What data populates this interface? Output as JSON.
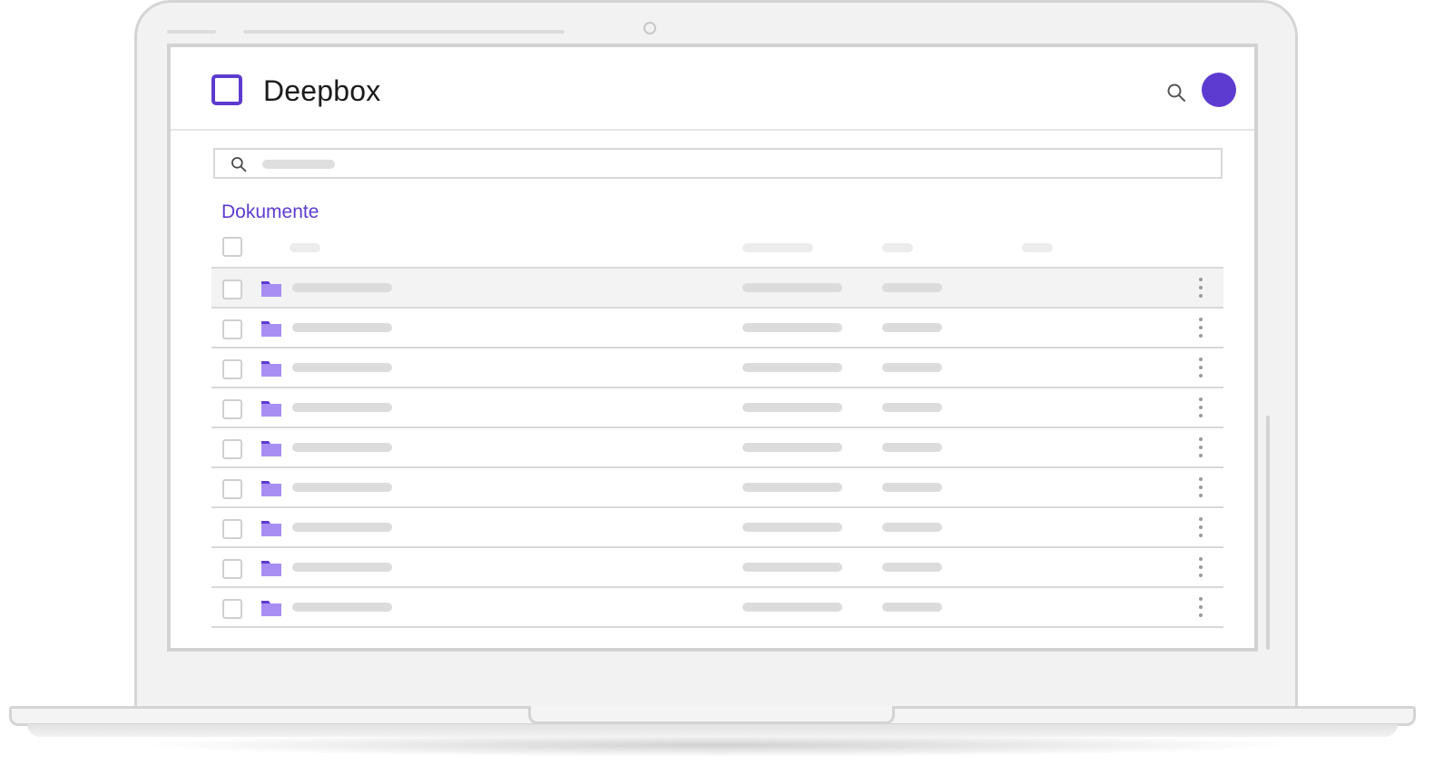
{
  "app": {
    "brand": "Deepbox",
    "accent_color": "#5d3bd0",
    "folder_color": "#a88ef2"
  },
  "header": {
    "search_icon": "search-icon",
    "avatar_icon": "avatar"
  },
  "search": {
    "icon": "search-icon",
    "placeholder": ""
  },
  "section": {
    "title": "Dokumente"
  },
  "table": {
    "row_count": 9,
    "row_icon": "folder-icon",
    "row_action_icon": "more-vertical-icon",
    "highlighted_row": 1
  }
}
